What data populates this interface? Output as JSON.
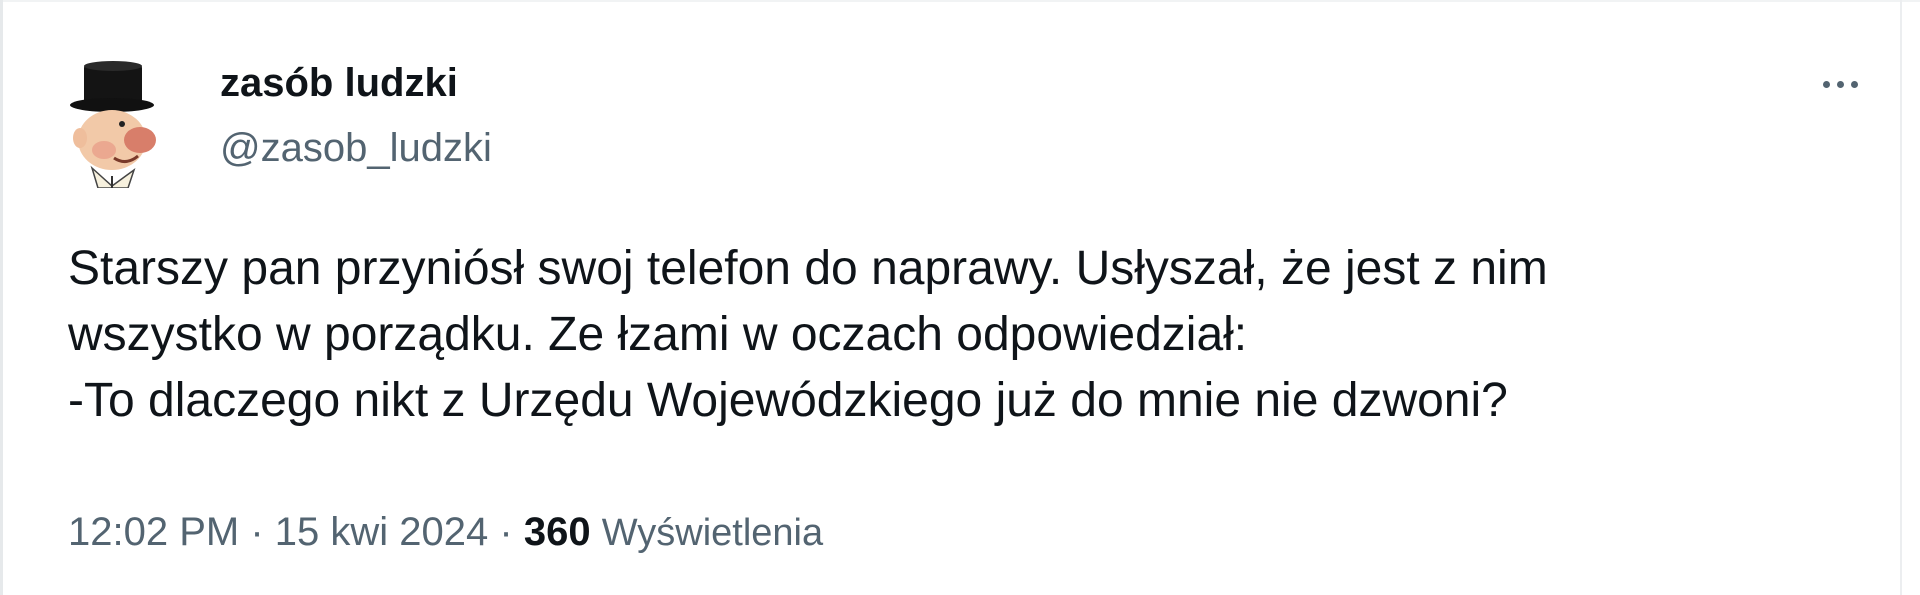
{
  "author": {
    "display_name": "zasób ludzki",
    "handle": "@zasob_ludzki",
    "avatar_icon": "top-hat-caricature-avatar"
  },
  "more_icon": "more-horizontal-icon",
  "tweet": {
    "lines": [
      "Starszy pan przyniósł swoj telefon do naprawy. Usłyszał, że jest z nim",
      "wszystko w porządku. Ze łzami w oczach odpowiedział:",
      "-To dlaczego nikt z Urzędu Wojewódzkiego już do mnie nie dzwoni?"
    ]
  },
  "meta": {
    "time": "12:02 PM",
    "separator": "·",
    "date": "15 kwi 2024",
    "views_count": "360",
    "views_label": "Wyświetlenia"
  },
  "colors": {
    "text_primary": "#0f1419",
    "text_secondary": "#536471",
    "background": "#ffffff"
  }
}
